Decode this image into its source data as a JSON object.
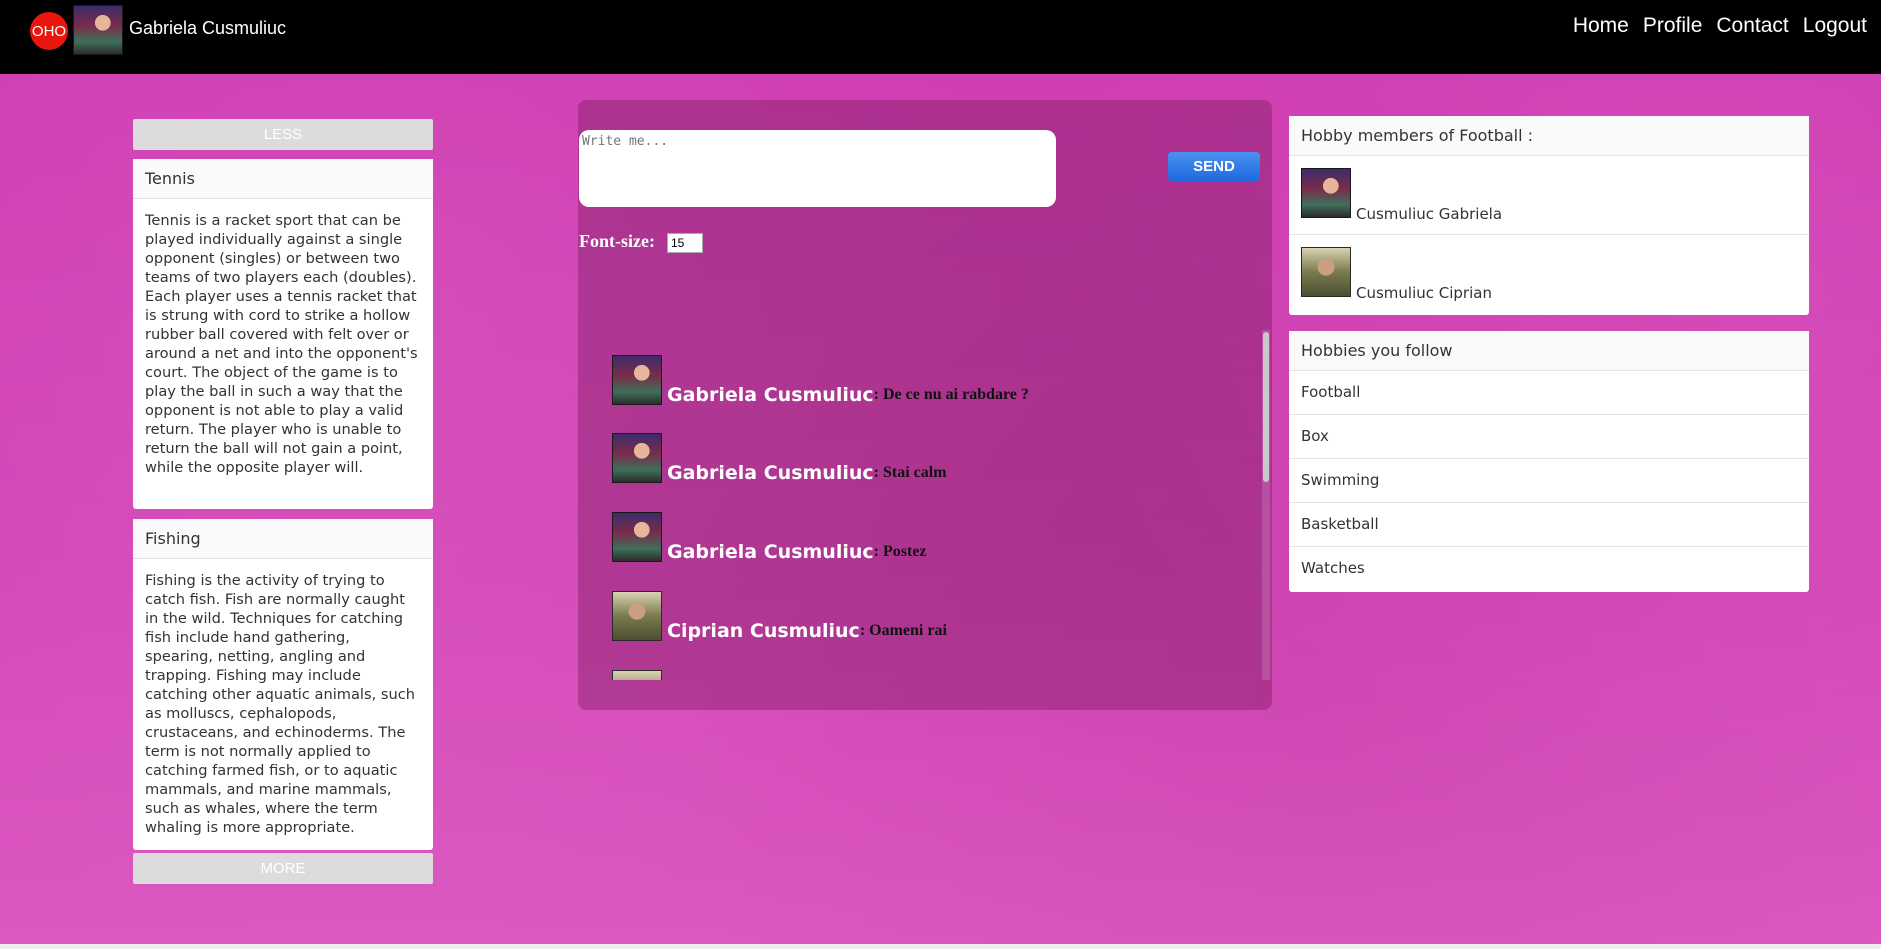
{
  "navbar": {
    "logo": "OHO",
    "username": "Gabriela Cusmuliuc",
    "links": [
      "Home",
      "Profile",
      "Contact",
      "Logout"
    ]
  },
  "left": {
    "less_label": "LESS",
    "more_label": "MORE",
    "cards": [
      {
        "title": "Tennis",
        "body": "Tennis is a racket sport that can be played individually against a single opponent (singles) or between two teams of two players each (doubles). Each player uses a tennis racket that is strung with cord to strike a hollow rubber ball covered with felt over or around a net and into the opponent's court. The object of the game is to play the ball in such a way that the opponent is not able to play a valid return. The player who is unable to return the ball will not gain a point, while the opposite player will."
      },
      {
        "title": "Fishing",
        "body": "Fishing is the activity of trying to catch fish. Fish are normally caught in the wild. Techniques for catching fish include hand gathering, spearing, netting, angling and trapping. Fishing may include catching other aquatic animals, such as molluscs, cephalopods, crustaceans, and echinoderms. The term is not normally applied to catching farmed fish, or to aquatic mammals, and marine mammals, such as whales, where the term whaling is more appropriate."
      }
    ]
  },
  "chat": {
    "placeholder": "Write me...",
    "send_label": "SEND",
    "font_size_label": "Font-size:",
    "font_size_value": "15",
    "messages": [
      {
        "author": "Gabriela Cusmuliuc",
        "text": ": De ce nu ai rabdare ?",
        "avatar": "gabriela"
      },
      {
        "author": "Gabriela Cusmuliuc",
        "text": ": Stai calm",
        "avatar": "gabriela"
      },
      {
        "author": "Gabriela Cusmuliuc",
        "text": ": Postez",
        "avatar": "gabriela"
      },
      {
        "author": "Ciprian Cusmuliuc",
        "text": ": Oameni rai",
        "avatar": "ciprian"
      }
    ]
  },
  "right": {
    "members_title": "Hobby members of Football :",
    "members": [
      {
        "name": "Cusmuliuc Gabriela",
        "avatar": "gabriela"
      },
      {
        "name": "Cusmuliuc Ciprian",
        "avatar": "ciprian"
      }
    ],
    "follow_title": "Hobbies you follow",
    "hobbies": [
      "Football",
      "Box",
      "Swimming",
      "Basketball",
      "Watches"
    ]
  }
}
